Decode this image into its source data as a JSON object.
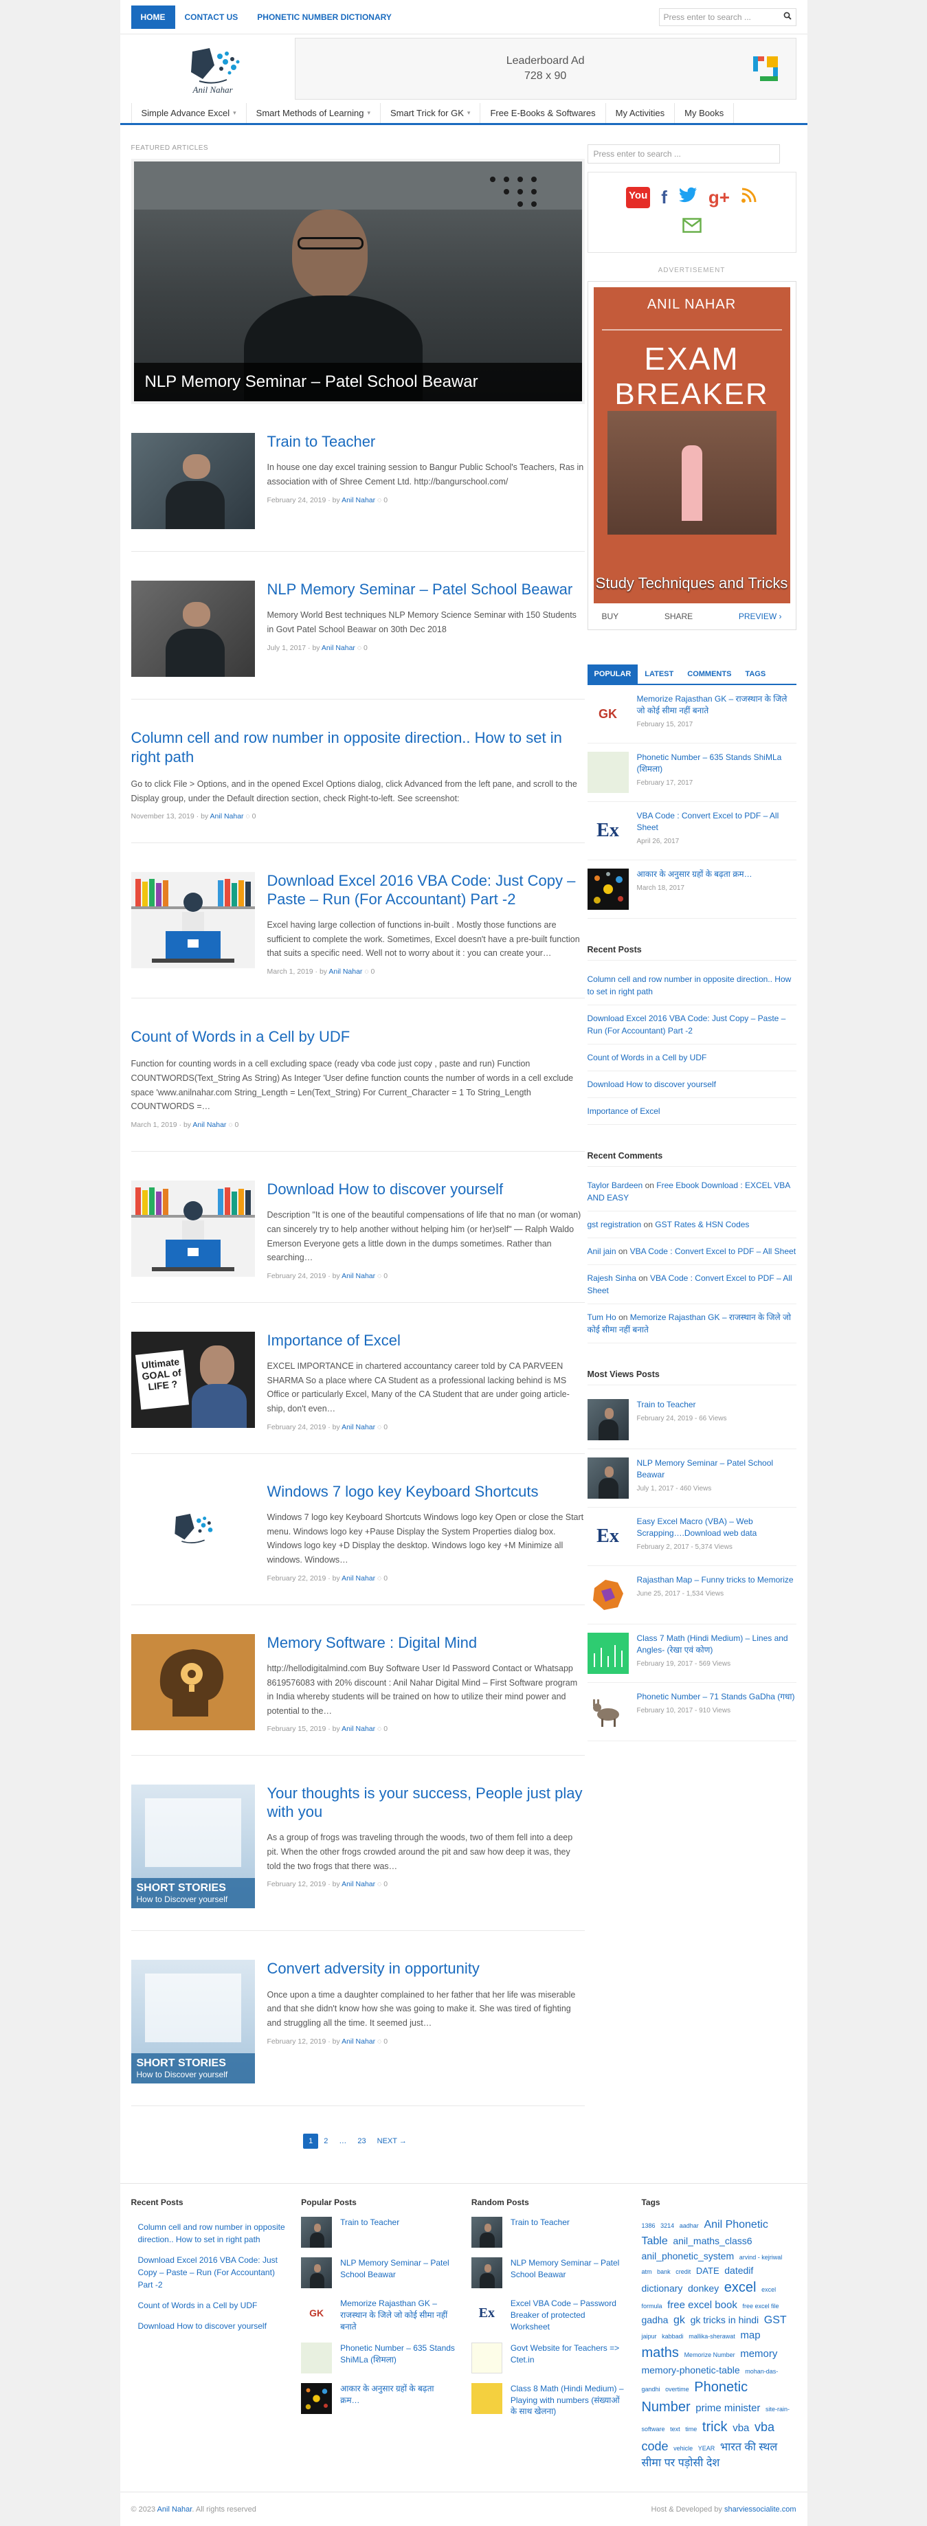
{
  "topnav": {
    "items": [
      "HOME",
      "CONTACT US",
      "PHONETIC NUMBER DICTIONARY"
    ],
    "search_placeholder": "Press enter to search ..."
  },
  "logo": {
    "text": "Anil Nahar"
  },
  "ad": {
    "title": "Leaderboard Ad",
    "size": "728 x 90"
  },
  "mainnav": {
    "items": [
      {
        "label": "Simple Advance Excel",
        "caret": true
      },
      {
        "label": "Smart Methods of Learning",
        "caret": true
      },
      {
        "label": "Smart Trick for GK",
        "caret": true
      },
      {
        "label": "Free E-Books & Softwares",
        "caret": false
      },
      {
        "label": "My Activities",
        "caret": false
      },
      {
        "label": "My Books",
        "caret": false
      }
    ]
  },
  "featured": {
    "label": "FEATURED ARTICLES",
    "title": "NLP Memory Seminar – Patel School Beawar"
  },
  "posts": [
    {
      "title": "Train to Teacher",
      "excerpt": "In house one day excel training session to Bangur Public School's Teachers, Ras in association with of Shree Cement Ltd. http://bangurschool.com/",
      "date": "February 24, 2019",
      "author": "Anil Nahar",
      "comments": "0"
    },
    {
      "title": "NLP Memory Seminar – Patel School Beawar",
      "excerpt": "Memory World Best techniques NLP Memory Science Seminar with 150 Students in Govt Patel School Beawar on 30th Dec 2018",
      "date": "July 1, 2017",
      "author": "Anil Nahar",
      "comments": "0"
    },
    {
      "title": "Column cell and row number in opposite direction.. How to set in right path",
      "excerpt": "Go to click File > Options, and in the opened Excel Options dialog, click Advanced from the left pane, and scroll to the Display group, under the Default direction section, check Right-to-left. See screenshot:",
      "date": "November 13, 2019",
      "author": "Anil Nahar",
      "comments": "0"
    },
    {
      "title": "Download Excel 2016 VBA Code: Just Copy – Paste – Run (For Accountant) Part -2",
      "excerpt": "Excel having large collection of functions in-built . Mostly those functions are sufficient to complete the work. Sometimes, Excel doesn't have a pre-built function that suits a specific need. Well not to worry about it : you can create your…",
      "date": "March 1, 2019",
      "author": "Anil Nahar",
      "comments": "0"
    },
    {
      "title": "Count of Words in a Cell by UDF",
      "excerpt": "Function for counting words in a cell excluding space (ready vba code just copy , paste and run) Function COUNTWORDS(Text_String As String) As Integer 'User define function counts the number of words in a cell exclude space 'www.anilnahar.com String_Length = Len(Text_String) For Current_Character = 1 To String_Length COUNTWORDS =…",
      "date": "March 1, 2019",
      "author": "Anil Nahar",
      "comments": "0"
    },
    {
      "title": "Download How to discover yourself",
      "excerpt": "Description \"It is one of the beautiful compensations of life that no man (or woman) can sincerely try to help another without helping him (or her)self\" — Ralph Waldo Emerson Everyone gets a little down in the dumps sometimes. Rather than searching…",
      "date": "February 24, 2019",
      "author": "Anil Nahar",
      "comments": "0"
    },
    {
      "title": "Importance of Excel",
      "excerpt": "EXCEL IMPORTANCE in chartered accountancy career told by CA PARVEEN SHARMA So a place where CA Student as a professional lacking behind is MS Office or particularly Excel, Many of the CA Student that are under going article-ship, don't even…",
      "date": "February 24, 2019",
      "author": "Anil Nahar",
      "comments": "0"
    },
    {
      "title": "Windows 7 logo key Keyboard Shortcuts",
      "excerpt": "Windows 7 logo key Keyboard Shortcuts Windows logo key Open or close the Start menu. Windows logo key +Pause Display the System Properties dialog box. Windows logo key +D Display the desktop. Windows logo key +M Minimize all windows. Windows…",
      "date": "February 22, 2019",
      "author": "Anil Nahar",
      "comments": "0"
    },
    {
      "title": "Memory Software : Digital Mind",
      "excerpt": "http://hellodigitalmind.com Buy Software User Id Password Contact or Whatsapp 8619576083 with 20% discount : Anil Nahar Digital Mind – First Software program in India whereby students will be trained on how to utilize their mind power and potential to the…",
      "date": "February 15, 2019",
      "author": "Anil Nahar",
      "comments": "0"
    },
    {
      "title": "Your thoughts is your success, People just play with you",
      "excerpt": "As a group of frogs was traveling through the woods, two of them fell into a deep pit. When the other frogs crowded around the pit and saw how deep it was, they told the two frogs that there was…",
      "date": "February 12, 2019",
      "author": "Anil Nahar",
      "comments": "0"
    },
    {
      "title": "Convert adversity in opportunity",
      "excerpt": "Once upon a time a daughter complained to her father that her life was miserable and that she didn't know how she was going to make it. She was tired of fighting and struggling all the time. It seemed just…",
      "date": "February 12, 2019",
      "author": "Anil Nahar",
      "comments": "0"
    }
  ],
  "post_meta": {
    "by": "by"
  },
  "pager": {
    "items": [
      "1",
      "2",
      "…",
      "23",
      "NEXT →"
    ]
  },
  "short_stories": {
    "line1": "SHORT STORIES",
    "line2": "How to Discover yourself"
  },
  "importance_thumb": "Ultimate GOAL of LIFE ?",
  "sidebar": {
    "search_placeholder": "Press enter to search ...",
    "advertisement": "ADVERTISEMENT",
    "book": {
      "author": "ANIL NAHAR",
      "title1": "EXAM",
      "title2": "BREAKER",
      "subtitle": "Study Techniques and Tricks",
      "buy": "BUY",
      "share": "SHARE",
      "preview": "PREVIEW"
    },
    "tabs": [
      "POPULAR",
      "LATEST",
      "COMMENTS",
      "TAGS"
    ],
    "popular": [
      {
        "title": "Memorize Rajasthan GK – राजस्थान के जिले जो कोई सीमा नहीं बनाते",
        "date": "February 15, 2017"
      },
      {
        "title": "Phonetic Number – 635 Stands ShiMLa (शिमला)",
        "date": "February 17, 2017"
      },
      {
        "title": "VBA Code : Convert Excel to PDF – All Sheet",
        "date": "April 26, 2017"
      },
      {
        "title": "आकार के अनुसार ग्रहों के बढ़ता क्रम…",
        "date": "March 18, 2017"
      }
    ],
    "recent_posts_title": "Recent Posts",
    "recent_posts": [
      "Column cell and row number in opposite direction.. How to set in right path",
      "Download Excel 2016 VBA Code: Just Copy – Paste – Run (For Accountant) Part -2",
      "Count of Words in a Cell by UDF",
      "Download How to discover yourself",
      "Importance of Excel"
    ],
    "recent_comments_title": "Recent Comments",
    "recent_comments": [
      {
        "author": "Taylor Bardeen",
        "on": "on",
        "post": "Free Ebook Download : EXCEL VBA AND EASY"
      },
      {
        "author": "gst registration",
        "on": "on",
        "post": "GST Rates & HSN Codes"
      },
      {
        "author": "Anil jain",
        "on": "on",
        "post": "VBA Code : Convert Excel to PDF – All Sheet"
      },
      {
        "author": "Rajesh Sinha",
        "on": "on",
        "post": "VBA Code : Convert Excel to PDF – All Sheet"
      },
      {
        "author": "Tum Ho",
        "on": "on",
        "post": "Memorize Rajasthan GK – राजस्थान के जिले जो कोई सीमा नहीं बनाते"
      }
    ],
    "most_viewed_title": "Most Views Posts",
    "most_viewed": [
      {
        "title": "Train to Teacher",
        "meta": "February 24, 2019 - 66 Views"
      },
      {
        "title": "NLP Memory Seminar – Patel School Beawar",
        "meta": "July 1, 2017 - 460 Views"
      },
      {
        "title": "Easy Excel Macro (VBA) – Web Scrapping….Download web data",
        "meta": "February 2, 2017 - 5,374 Views"
      },
      {
        "title": "Rajasthan Map – Funny tricks to Memorize",
        "meta": "June 25, 2017 - 1,534 Views"
      },
      {
        "title": "Class 7 Math (Hindi Medium) – Lines and Angles- (रेखा एवं कोण)",
        "meta": "February 19, 2017 - 569 Views"
      },
      {
        "title": "Phonetic Number – 71 Stands GaDha (गधा)",
        "meta": "February 10, 2017 - 910 Views"
      }
    ]
  },
  "footer": {
    "recent_title": "Recent Posts",
    "recent": [
      "Column cell and row number in opposite direction.. How to set in right path",
      "Download Excel 2016 VBA Code: Just Copy – Paste – Run (For Accountant) Part -2",
      "Count of Words in a Cell by UDF",
      "Download How to discover yourself"
    ],
    "popular_title": "Popular Posts",
    "popular": [
      "Train to Teacher",
      "NLP Memory Seminar – Patel School Beawar",
      "Memorize Rajasthan GK – राजस्थान के जिले जो कोई सीमा नहीं बनाते",
      "Phonetic Number – 635 Stands ShiMLa (शिमला)",
      "आकार के अनुसार ग्रहों के बढ़ता क्रम…"
    ],
    "random_title": "Random Posts",
    "random": [
      "Train to Teacher",
      "NLP Memory Seminar – Patel School Beawar",
      "Excel VBA Code – Password Breaker of protected Worksheet",
      "Govt Website for Teachers => Ctet.in",
      "Class 8 Math (Hindi Medium) – Playing with numbers (संख्याओं के साथ खेलना)"
    ],
    "tags_title": "Tags",
    "tags": [
      {
        "t": "1386",
        "s": 9
      },
      {
        "t": "3214",
        "s": 9
      },
      {
        "t": "aadhar",
        "s": 9
      },
      {
        "t": "Anil Phonetic Table",
        "s": 16
      },
      {
        "t": "anil_maths_class6",
        "s": 14
      },
      {
        "t": "anil_phonetic_system",
        "s": 14
      },
      {
        "t": "arvind - kejriwal",
        "s": 9
      },
      {
        "t": "atm",
        "s": 9
      },
      {
        "t": "bank",
        "s": 9
      },
      {
        "t": "credit",
        "s": 9
      },
      {
        "t": "DATE",
        "s": 13
      },
      {
        "t": "datedif",
        "s": 14
      },
      {
        "t": "dictionary",
        "s": 14
      },
      {
        "t": "donkey",
        "s": 14
      },
      {
        "t": "excel",
        "s": 20
      },
      {
        "t": "excel formula",
        "s": 9
      },
      {
        "t": "free excel book",
        "s": 15
      },
      {
        "t": "free excel file",
        "s": 9
      },
      {
        "t": "gadha",
        "s": 14
      },
      {
        "t": "gk",
        "s": 16
      },
      {
        "t": "gk tricks in hindi",
        "s": 14
      },
      {
        "t": "GST",
        "s": 16
      },
      {
        "t": "jaipur",
        "s": 9
      },
      {
        "t": "kabbadi",
        "s": 9
      },
      {
        "t": "mallika-sherawat",
        "s": 9
      },
      {
        "t": "map",
        "s": 15
      },
      {
        "t": "maths",
        "s": 20
      },
      {
        "t": "Memorize Number",
        "s": 9
      },
      {
        "t": "memory",
        "s": 15
      },
      {
        "t": "memory-phonetic-table",
        "s": 14
      },
      {
        "t": "mohan-das-gandhi",
        "s": 9
      },
      {
        "t": "overtime",
        "s": 9
      },
      {
        "t": "Phonetic Number",
        "s": 20
      },
      {
        "t": "prime minister",
        "s": 15
      },
      {
        "t": "site-rain-software",
        "s": 9
      },
      {
        "t": "text",
        "s": 9
      },
      {
        "t": "time",
        "s": 9
      },
      {
        "t": "trick",
        "s": 20
      },
      {
        "t": "vba",
        "s": 15
      },
      {
        "t": "vba code",
        "s": 18
      },
      {
        "t": "vehicle",
        "s": 9
      },
      {
        "t": "YEAR",
        "s": 9
      },
      {
        "t": "भारत की स्थल सीमा पर पड़ोसी देश",
        "s": 16
      }
    ]
  },
  "copyright": {
    "left": "© 2023",
    "author": "Anil Nahar",
    "rights": ". All rights reserved",
    "right": "Host & Developed by",
    "dev": "sharviessocialite.com"
  },
  "colors": {
    "accent": "#1a6bbf"
  }
}
